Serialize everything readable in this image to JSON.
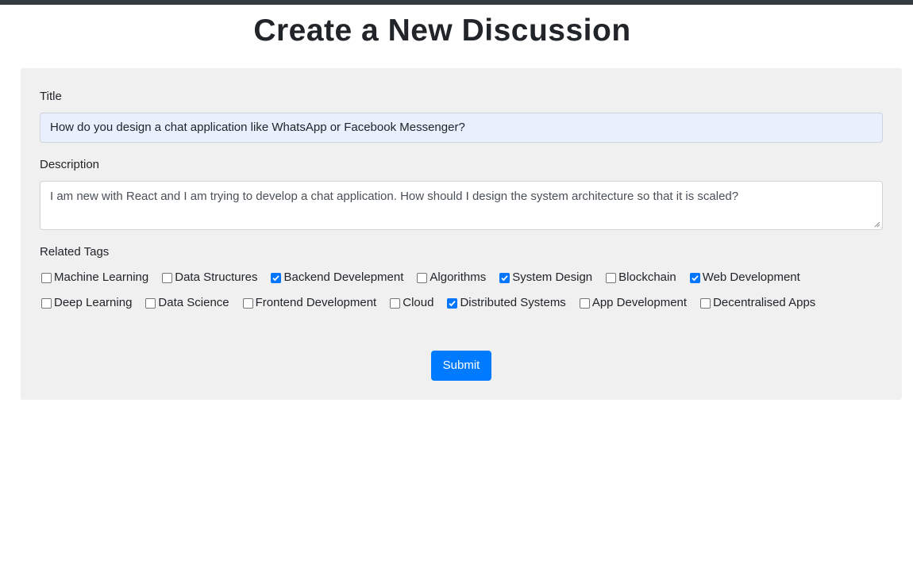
{
  "page": {
    "title": "Create a New Discussion"
  },
  "form": {
    "title_label": "Title",
    "title_value": "How do you design a chat application like WhatsApp or Facebook Messenger?",
    "description_label": "Description",
    "description_value": "I am new with React and I am trying to develop a chat application. How should I design the system architecture so that it is scaled?",
    "tags_label": "Related Tags",
    "tags_row1": [
      {
        "label": "Machine Learning",
        "checked": false
      },
      {
        "label": "Data Structures",
        "checked": false
      },
      {
        "label": "Backend Develepment",
        "checked": true
      },
      {
        "label": "Algorithms",
        "checked": false
      },
      {
        "label": "System Design",
        "checked": true
      },
      {
        "label": "Blockchain",
        "checked": false
      },
      {
        "label": "Web Development",
        "checked": true
      }
    ],
    "tags_row2": [
      {
        "label": "Deep Learning",
        "checked": false
      },
      {
        "label": "Data Science",
        "checked": false
      },
      {
        "label": "Frontend Development",
        "checked": false
      },
      {
        "label": "Cloud",
        "checked": false
      },
      {
        "label": "Distributed Systems",
        "checked": true
      },
      {
        "label": "App Development",
        "checked": false
      },
      {
        "label": "Decentralised Apps",
        "checked": false
      }
    ],
    "submit_label": "Submit"
  },
  "colors": {
    "topbar": "#343a40",
    "card_background": "#f0f0f0",
    "primary": "#007bff",
    "checkbox_checked": "#0075ff",
    "title_input_background": "#e8f0fe"
  }
}
